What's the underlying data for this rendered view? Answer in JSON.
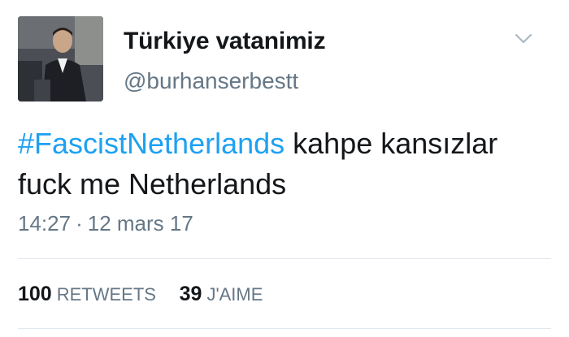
{
  "tweet": {
    "author": {
      "display_name": "Türkiye vatanimiz",
      "handle": "@burhanserbestt",
      "avatar": "profile-photo"
    },
    "hashtag": "#FascistNetherlands",
    "text_line1_rest": " kahpe kansızlar",
    "text_line2": "fuck me Netherlands",
    "time": "14:27",
    "separator": "·",
    "date": "12 mars 17",
    "menu_icon": "chevron-down-icon",
    "stats": {
      "retweets_count": "100",
      "retweets_label": "RETWEETS",
      "likes_count": "39",
      "likes_label": "J'AIME"
    }
  },
  "colors": {
    "link": "#1da1f2",
    "secondary_text": "#657786",
    "primary_text": "#14171a",
    "divider": "#e1e8ed"
  }
}
